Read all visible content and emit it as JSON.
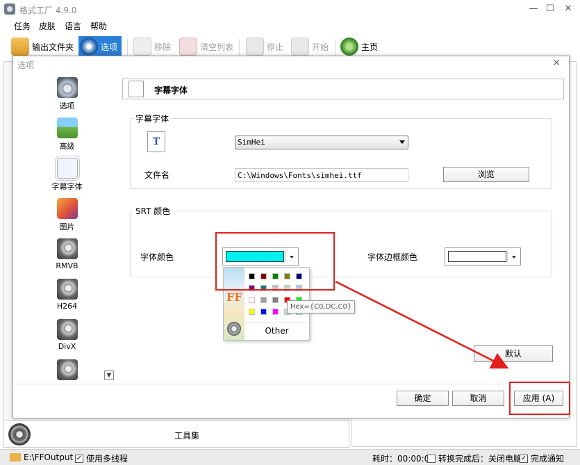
{
  "app": {
    "title": "格式工厂 4.9.0",
    "window_buttons": {
      "minimize": "—",
      "maximize": "☐",
      "close": "✕"
    }
  },
  "menu": [
    "任务",
    "皮肤",
    "语言",
    "帮助"
  ],
  "toolbar": {
    "output_folder": "输出文件夹",
    "options": "选项",
    "remove": "移除",
    "clear_list": "清空列表",
    "stop": "停止",
    "start": "开始",
    "home": "主页"
  },
  "dialog": {
    "title": "选项",
    "close": "✕",
    "nav": [
      {
        "label": "选项",
        "icon": "options-gear-icon"
      },
      {
        "label": "高级",
        "icon": "landscape-icon"
      },
      {
        "label": "字幕字体",
        "icon": "subtitle-document-icon"
      },
      {
        "label": "图片",
        "icon": "picture-icon"
      },
      {
        "label": "RMVB",
        "icon": "film-reel-icon"
      },
      {
        "label": "H264",
        "icon": "film-reel-icon"
      },
      {
        "label": "DivX",
        "icon": "film-reel-icon"
      },
      {
        "label": "",
        "icon": "film-reel-icon"
      }
    ],
    "nav_scroll": "▼",
    "header_title": "字幕字体",
    "font_group": {
      "title": "字幕字体",
      "font_icon": "T",
      "font_value": "SimHei",
      "filename_label": "文件名",
      "filename_value": "C:\\Windows\\Fonts\\simhei.ttf",
      "browse": "浏览"
    },
    "srt_group": {
      "title": "SRT 颜色",
      "font_color_label": "字体颜色",
      "font_color": "#00F0F0",
      "border_color_label": "字体边框颜色",
      "border_color": "#FFFFFF"
    },
    "palette": {
      "rows": [
        [
          "#000000",
          "#800000",
          "#008000",
          "#808000",
          "#000080"
        ],
        [
          "#800080",
          "#008080",
          "#C0C0C0",
          "#C0DCC0",
          "#A6CAF0"
        ],
        [
          "#FFFBF0",
          "#A0A0A4",
          "#808080",
          "#FF0000",
          "#00FF00"
        ],
        [
          "#FFFF00",
          "#0000FF",
          "#FF00FF",
          "#C0DCC0",
          ""
        ]
      ],
      "tooltip": "Hex={C0,DC,C0}",
      "other": "Other",
      "ff_icon": "FF"
    },
    "default": "默认",
    "ok": "确定",
    "cancel": "取消",
    "apply": "应用 (A)"
  },
  "toolset": {
    "label": "工具集"
  },
  "status": {
    "output_path": "E:\\FFOutput",
    "multithread": "使用多线程",
    "multithread_check": "✓",
    "elapsed": "耗时：00:00:00",
    "after_done": "转换完成后：关闭电脑",
    "notify": "完成通知",
    "notify_check": "✓"
  },
  "annotation_color": "#E0201C"
}
